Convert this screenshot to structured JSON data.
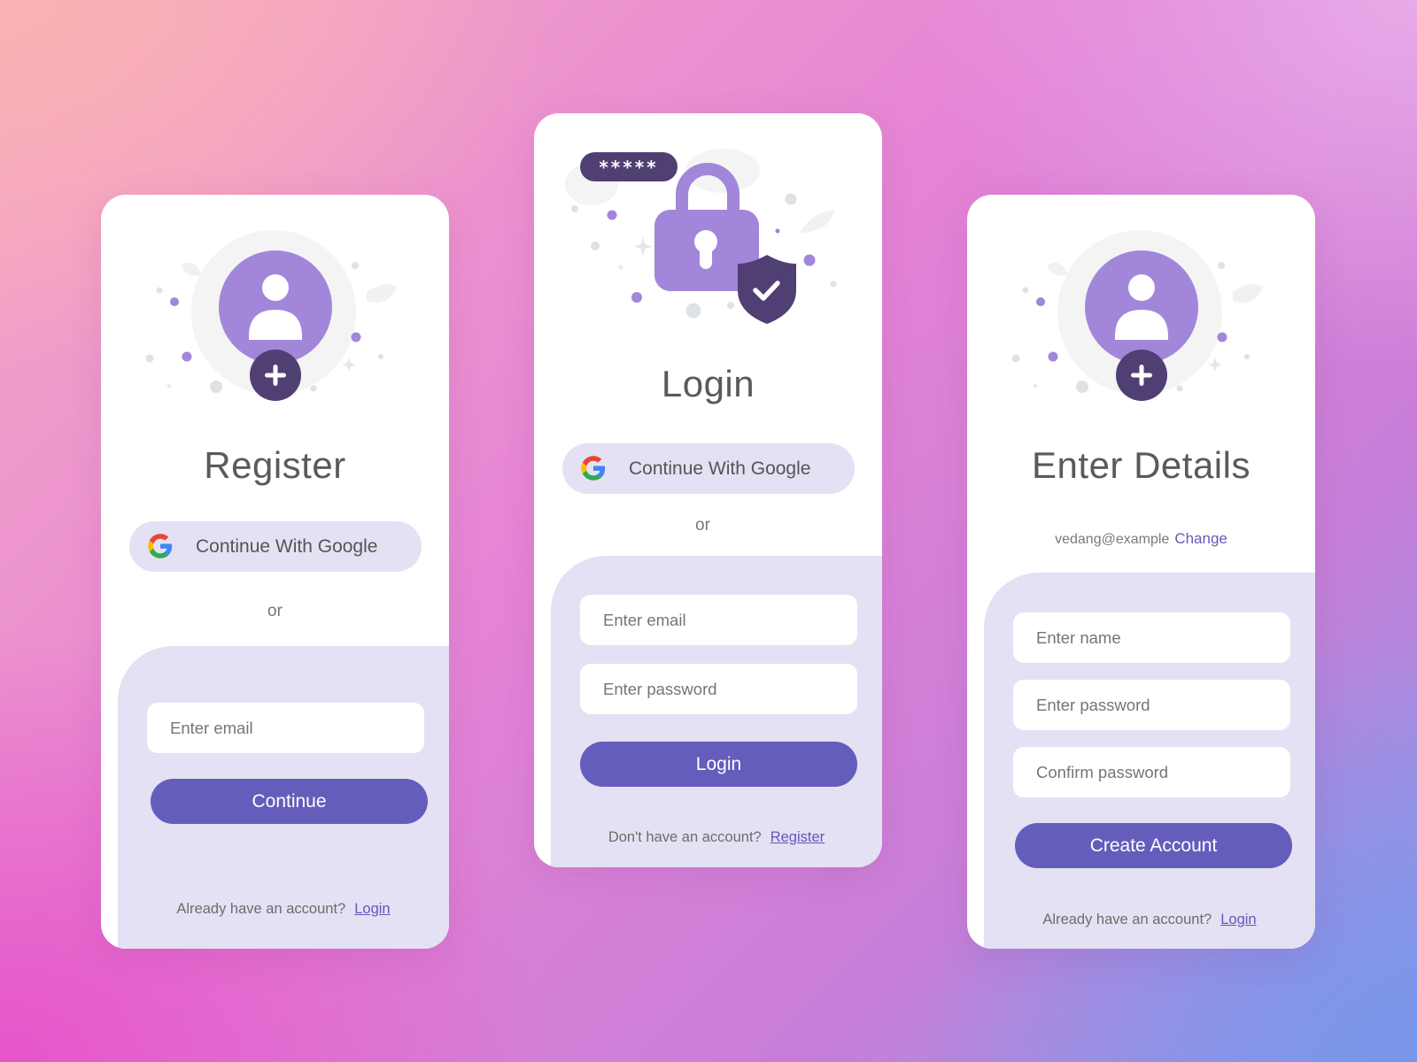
{
  "colors": {
    "primary": "#645dbb",
    "accent_light": "#e3e1f3",
    "illustration_purple": "#a286da",
    "illustration_dark": "#4f3f72",
    "link": "#6359b8"
  },
  "register": {
    "illustration": "user-avatar-add-icon",
    "title": "Register",
    "google_button": "Continue With Google",
    "or": "or",
    "email_placeholder": "Enter email",
    "continue_button": "Continue",
    "footer_text": "Already have an account?",
    "footer_link": "Login"
  },
  "login": {
    "illustration": "padlock-shield-icon",
    "password_badge": "*****",
    "title": "Login",
    "google_button": "Continue With Google",
    "or": "or",
    "email_placeholder": "Enter email",
    "password_placeholder": "Enter password",
    "login_button": "Login",
    "footer_text": "Don't have an account?",
    "footer_link": "Register"
  },
  "details": {
    "illustration": "user-avatar-add-icon",
    "title": "Enter Details",
    "email": "vedang@example",
    "change_link": "Change",
    "name_placeholder": "Enter name",
    "password_placeholder": "Enter password",
    "confirm_placeholder": "Confirm password",
    "create_button": "Create Account",
    "footer_text": "Already have an account?",
    "footer_link": "Login"
  }
}
